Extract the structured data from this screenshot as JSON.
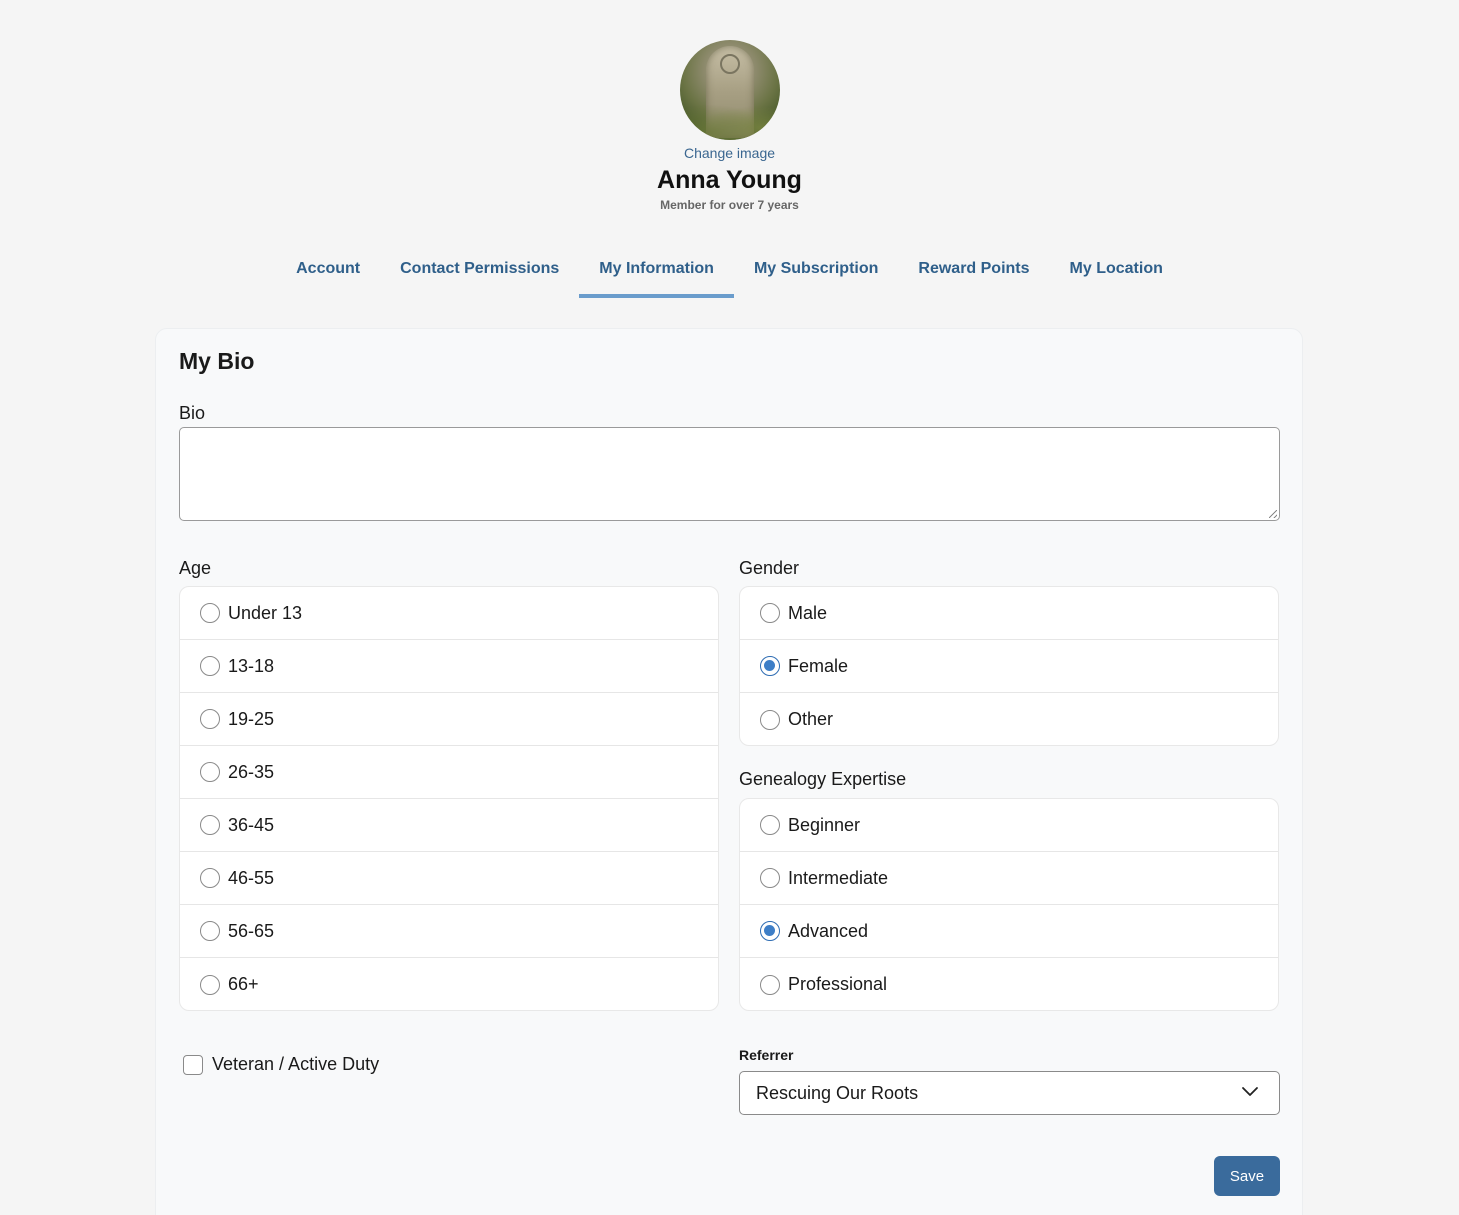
{
  "profile": {
    "change_image": "Change image",
    "name": "Anna Young",
    "member_since": "Member for over 7 years"
  },
  "tabs": [
    {
      "label": "Account",
      "active": false
    },
    {
      "label": "Contact Permissions",
      "active": false
    },
    {
      "label": "My Information",
      "active": true
    },
    {
      "label": "My Subscription",
      "active": false
    },
    {
      "label": "Reward Points",
      "active": false
    },
    {
      "label": "My Location",
      "active": false
    }
  ],
  "bio_section": {
    "title": "My Bio",
    "bio_label": "Bio",
    "bio_value": ""
  },
  "age": {
    "label": "Age",
    "options": [
      "Under 13",
      "13-18",
      "19-25",
      "26-35",
      "36-45",
      "46-55",
      "56-65",
      "66+"
    ],
    "selected": null
  },
  "gender": {
    "label": "Gender",
    "options": [
      "Male",
      "Female",
      "Other"
    ],
    "selected": "Female"
  },
  "expertise": {
    "label": "Genealogy Expertise",
    "options": [
      "Beginner",
      "Intermediate",
      "Advanced",
      "Professional"
    ],
    "selected": "Advanced"
  },
  "veteran": {
    "label": "Veteran / Active Duty",
    "checked": false
  },
  "referrer": {
    "label": "Referrer",
    "value": "Rescuing Our Roots"
  },
  "actions": {
    "save_label": "Save"
  },
  "colors": {
    "accent": "#2f5f8a",
    "tab_underline": "#6a9ccc",
    "button": "#3a6b9c",
    "radio_checked": "#3d7ec7"
  }
}
